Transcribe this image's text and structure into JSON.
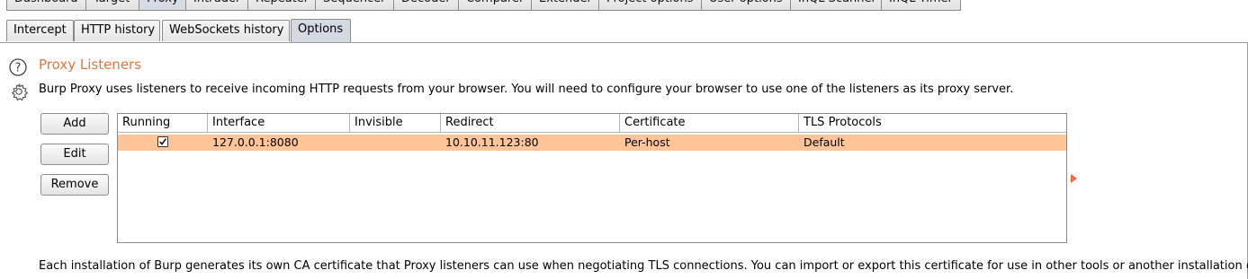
{
  "top_tabs": [
    {
      "label": "Dashboard"
    },
    {
      "label": "Target"
    },
    {
      "label": "Proxy"
    },
    {
      "label": "Intruder"
    },
    {
      "label": "Repeater"
    },
    {
      "label": "Sequencer"
    },
    {
      "label": "Decoder"
    },
    {
      "label": "Comparer"
    },
    {
      "label": "Extender"
    },
    {
      "label": "Project options"
    },
    {
      "label": "User options"
    },
    {
      "label": "InQL Scanner"
    },
    {
      "label": "InQL Timer"
    }
  ],
  "sub_tabs": [
    {
      "label": "Intercept"
    },
    {
      "label": "HTTP history"
    },
    {
      "label": "WebSockets history"
    },
    {
      "label": "Options"
    }
  ],
  "section": {
    "title": "Proxy Listeners",
    "description": "Burp Proxy uses listeners to receive incoming HTTP requests from your browser. You will need to configure your browser to use one of the listeners as its proxy server."
  },
  "buttons": {
    "add": "Add",
    "edit": "Edit",
    "remove": "Remove"
  },
  "table": {
    "columns": [
      "Running",
      "Interface",
      "Invisible",
      "Redirect",
      "Certificate",
      "TLS Protocols"
    ],
    "rows": [
      {
        "running": true,
        "interface": "127.0.0.1:8080",
        "invisible": "",
        "redirect": "10.10.11.123:80",
        "certificate": "Per-host",
        "tls": "Default"
      }
    ]
  },
  "footer": "Each installation of Burp generates its own CA certificate that Proxy listeners can use when negotiating TLS connections. You can import or export this certificate for use in other tools or another installation of Bur",
  "colors": {
    "accent": "#e8743b",
    "selected_row": "#ffc599"
  },
  "icons": {
    "help": "help-icon",
    "settings": "gear-icon",
    "checkbox": "checkbox-checked-icon"
  }
}
